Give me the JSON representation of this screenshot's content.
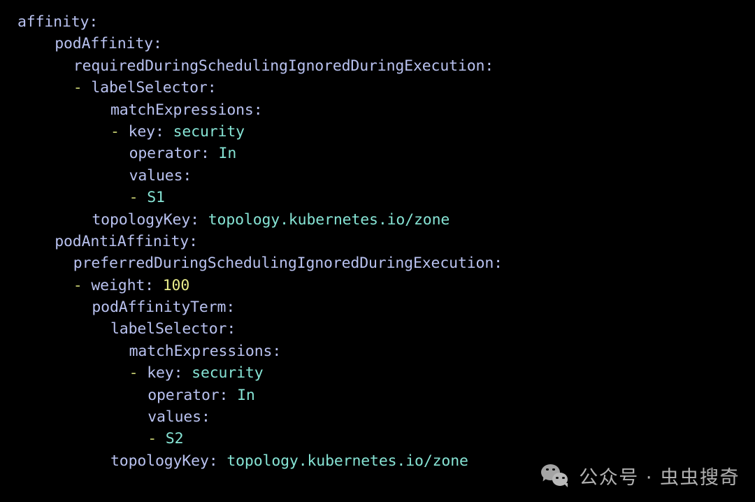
{
  "editor": {
    "background": "#000000",
    "key_color": "#b9c2f0",
    "value_color": "#86e3d4",
    "number_color": "#e8ec8a",
    "dash_color": "#c7cf72",
    "language": "yaml",
    "lines": [
      {
        "indent": 0,
        "dash": false,
        "key": "affinity",
        "sep": ":",
        "value": "",
        "value_type": "none"
      },
      {
        "indent": 4,
        "dash": false,
        "key": "podAffinity",
        "sep": ":",
        "value": "",
        "value_type": "none"
      },
      {
        "indent": 6,
        "dash": false,
        "key": "requiredDuringSchedulingIgnoredDuringExecution",
        "sep": ":",
        "value": "",
        "value_type": "none"
      },
      {
        "indent": 6,
        "dash": true,
        "key": "labelSelector",
        "sep": ":",
        "value": "",
        "value_type": "none"
      },
      {
        "indent": 10,
        "dash": false,
        "key": "matchExpressions",
        "sep": ":",
        "value": "",
        "value_type": "none"
      },
      {
        "indent": 10,
        "dash": true,
        "key": "key",
        "sep": ":",
        "value": "security",
        "value_type": "string"
      },
      {
        "indent": 12,
        "dash": false,
        "key": "operator",
        "sep": ":",
        "value": "In",
        "value_type": "string"
      },
      {
        "indent": 12,
        "dash": false,
        "key": "values",
        "sep": ":",
        "value": "",
        "value_type": "none"
      },
      {
        "indent": 12,
        "dash": true,
        "key": "",
        "sep": "",
        "value": "S1",
        "value_type": "string"
      },
      {
        "indent": 8,
        "dash": false,
        "key": "topologyKey",
        "sep": ":",
        "value": "topology.kubernetes.io/zone",
        "value_type": "string"
      },
      {
        "indent": 4,
        "dash": false,
        "key": "podAntiAffinity",
        "sep": ":",
        "value": "",
        "value_type": "none"
      },
      {
        "indent": 6,
        "dash": false,
        "key": "preferredDuringSchedulingIgnoredDuringExecution",
        "sep": ":",
        "value": "",
        "value_type": "none"
      },
      {
        "indent": 6,
        "dash": true,
        "key": "weight",
        "sep": ":",
        "value": "100",
        "value_type": "number"
      },
      {
        "indent": 8,
        "dash": false,
        "key": "podAffinityTerm",
        "sep": ":",
        "value": "",
        "value_type": "none"
      },
      {
        "indent": 10,
        "dash": false,
        "key": "labelSelector",
        "sep": ":",
        "value": "",
        "value_type": "none"
      },
      {
        "indent": 12,
        "dash": false,
        "key": "matchExpressions",
        "sep": ":",
        "value": "",
        "value_type": "none"
      },
      {
        "indent": 12,
        "dash": true,
        "key": "key",
        "sep": ":",
        "value": "security",
        "value_type": "string"
      },
      {
        "indent": 14,
        "dash": false,
        "key": "operator",
        "sep": ":",
        "value": "In",
        "value_type": "string"
      },
      {
        "indent": 14,
        "dash": false,
        "key": "values",
        "sep": ":",
        "value": "",
        "value_type": "none"
      },
      {
        "indent": 14,
        "dash": true,
        "key": "",
        "sep": "",
        "value": "S2",
        "value_type": "string"
      },
      {
        "indent": 10,
        "dash": false,
        "key": "topologyKey",
        "sep": ":",
        "value": "topology.kubernetes.io/zone",
        "value_type": "string"
      }
    ]
  },
  "watermark": {
    "icon": "wechat-logo-icon",
    "text": "公众号 · 虫虫搜奇"
  }
}
